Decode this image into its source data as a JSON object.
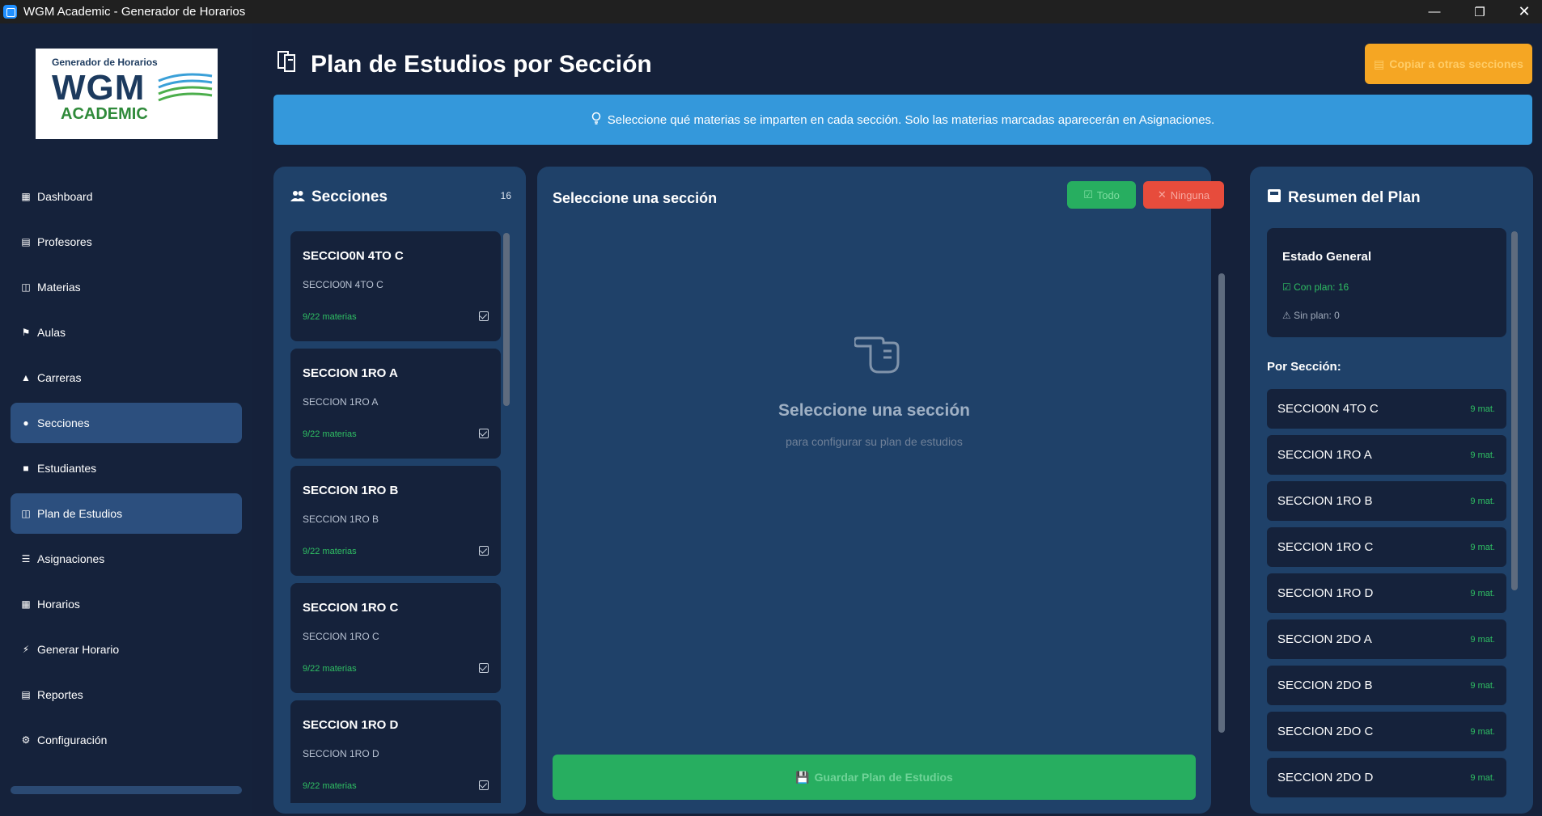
{
  "window": {
    "title": "WGM Academic - Generador de Horarios"
  },
  "logo": {
    "line1": "Generador de Horarios",
    "line2": "WGM",
    "line3": "ACADEMIC"
  },
  "nav": [
    {
      "label": "Dashboard",
      "icon": "dashboard-icon",
      "active": false
    },
    {
      "label": "Profesores",
      "icon": "teacher-icon",
      "active": false
    },
    {
      "label": "Materias",
      "icon": "books-icon",
      "active": false
    },
    {
      "label": "Aulas",
      "icon": "school-icon",
      "active": false
    },
    {
      "label": "Carreras",
      "icon": "graduation-cap-icon",
      "active": false
    },
    {
      "label": "Secciones",
      "icon": "users-icon",
      "active": true
    },
    {
      "label": "Estudiantes",
      "icon": "student-icon",
      "active": false
    },
    {
      "label": "Plan de Estudios",
      "icon": "books-icon",
      "active": true
    },
    {
      "label": "Asignaciones",
      "icon": "list-icon",
      "active": false
    },
    {
      "label": "Horarios",
      "icon": "calendar-icon",
      "active": false
    },
    {
      "label": "Generar Horario",
      "icon": "bolt-icon",
      "active": false
    },
    {
      "label": "Reportes",
      "icon": "chart-icon",
      "active": false
    },
    {
      "label": "Configuración",
      "icon": "gear-icon",
      "active": false
    }
  ],
  "header": {
    "title": "Plan de Estudios por Sección",
    "copy_button": "Copiar a otras secciones"
  },
  "info": {
    "text": "Seleccione qué materias se imparten en cada sección. Solo las materias marcadas aparecerán en Asignaciones."
  },
  "sections_panel": {
    "title": "Secciones",
    "count": "16",
    "items": [
      {
        "name": "SECCIO0N 4TO C",
        "sub": "SECCIO0N 4TO C",
        "mats": "9/22 materias"
      },
      {
        "name": "SECCION 1RO A",
        "sub": "SECCION 1RO A",
        "mats": "9/22 materias"
      },
      {
        "name": "SECCION 1RO B",
        "sub": "SECCION 1RO B",
        "mats": "9/22 materias"
      },
      {
        "name": "SECCION 1RO C",
        "sub": "SECCION 1RO C",
        "mats": "9/22 materias"
      },
      {
        "name": "SECCION 1RO D",
        "sub": "SECCION 1RO D",
        "mats": "9/22 materias"
      }
    ]
  },
  "center": {
    "title": "Seleccione una sección",
    "all_button": "Todo",
    "none_button": "Ninguna",
    "empty_title": "Seleccione una sección",
    "empty_sub": "para configurar su plan de estudios",
    "save_button": "Guardar Plan de Estudios"
  },
  "summary": {
    "title": "Resumen del Plan",
    "estado_title": "Estado General",
    "con_plan": "Con plan: 16",
    "sin_plan": "Sin plan: 0",
    "por_seccion": "Por Sección:",
    "items": [
      {
        "name": "SECCIO0N 4TO C",
        "mat": "9 mat."
      },
      {
        "name": "SECCION 1RO A",
        "mat": "9 mat."
      },
      {
        "name": "SECCION 1RO B",
        "mat": "9 mat."
      },
      {
        "name": "SECCION 1RO C",
        "mat": "9 mat."
      },
      {
        "name": "SECCION 1RO D",
        "mat": "9 mat."
      },
      {
        "name": "SECCION 2DO A",
        "mat": "9 mat."
      },
      {
        "name": "SECCION 2DO B",
        "mat": "9 mat."
      },
      {
        "name": "SECCION 2DO C",
        "mat": "9 mat."
      },
      {
        "name": "SECCION 2DO D",
        "mat": "9 mat."
      }
    ]
  },
  "colors": {
    "accent_green": "#27ae60",
    "accent_red": "#e74c3c",
    "accent_orange": "#f5a623",
    "info_blue": "#3498db",
    "panel": "#1f4169",
    "card": "#15223b"
  }
}
